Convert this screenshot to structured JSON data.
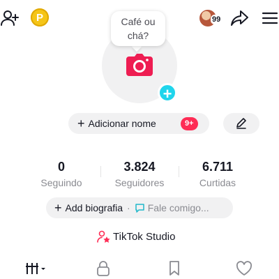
{
  "header": {
    "notification_count": "99",
    "add_user_icon": "add-user-icon",
    "coin_icon": "coin-icon",
    "coin_letter": "P",
    "share_icon": "share-icon",
    "menu_icon": "menu-icon"
  },
  "avatar": {
    "bubble_text": "Café ou chá?",
    "camera_icon": "camera-icon",
    "add_badge": "+"
  },
  "name": {
    "label": "Adicionar nome",
    "plus": "+",
    "badge": "9+",
    "edit_icon": "pencil-icon"
  },
  "stats": [
    {
      "value": "0",
      "label": "Seguindo"
    },
    {
      "value": "3.824",
      "label": "Seguidores"
    },
    {
      "value": "6.711",
      "label": "Curtidas"
    }
  ],
  "bio": {
    "plus": "+",
    "label": "Add biografia",
    "separator": "·",
    "message": "Fale comigo..."
  },
  "studio": {
    "label": "TikTok Studio",
    "icon": "tiktok-studio-icon"
  },
  "tabs": [
    {
      "name": "videos",
      "icon": "grid-bars-icon"
    },
    {
      "name": "private",
      "icon": "lock-icon"
    },
    {
      "name": "saved",
      "icon": "bookmark-icon"
    },
    {
      "name": "liked",
      "icon": "heart-icon"
    }
  ],
  "colors": {
    "accent_red": "#fe2c55",
    "accent_cyan": "#20d5ec",
    "camera_red": "#ee1d52",
    "pill_gray": "#f1f1f2",
    "muted_text": "#8a8b91",
    "coin_gold": "#f5c518"
  }
}
